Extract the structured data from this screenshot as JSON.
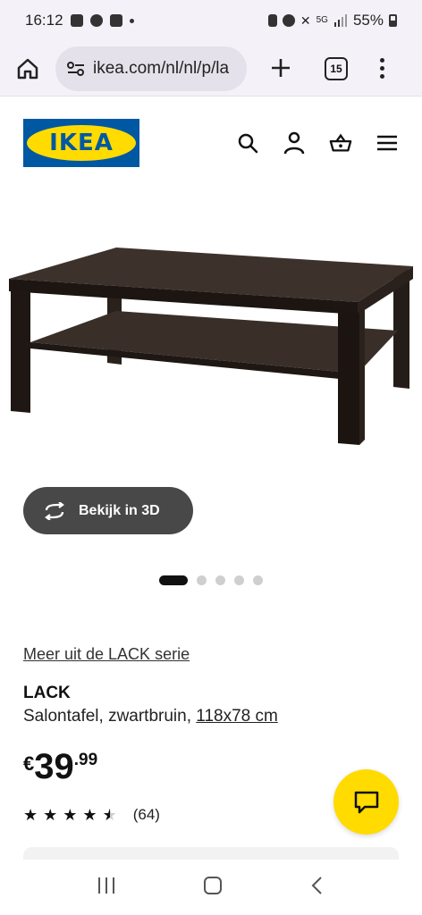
{
  "status_bar": {
    "time": "16:12",
    "network": "5G",
    "battery": "55%"
  },
  "browser": {
    "url": "ikea.com/nl/nl/p/la",
    "tab_count": "15"
  },
  "header": {
    "logo_text": "IKEA"
  },
  "product": {
    "view_3d_label": "Bekijk in 3D",
    "carousel": {
      "total": 5,
      "active": 1
    },
    "series_link": "Meer uit de LACK serie",
    "name": "LACK",
    "description": "Salontafel, zwartbruin,",
    "dimensions": "118x78 cm",
    "price": {
      "currency": "€",
      "integer": "39",
      "decimal": ".99"
    },
    "rating": {
      "stars": 4.5,
      "count": "(64)"
    }
  },
  "colors": {
    "ikea_blue": "#0058a3",
    "ikea_yellow": "#ffdb00",
    "dark_button": "#484848"
  }
}
